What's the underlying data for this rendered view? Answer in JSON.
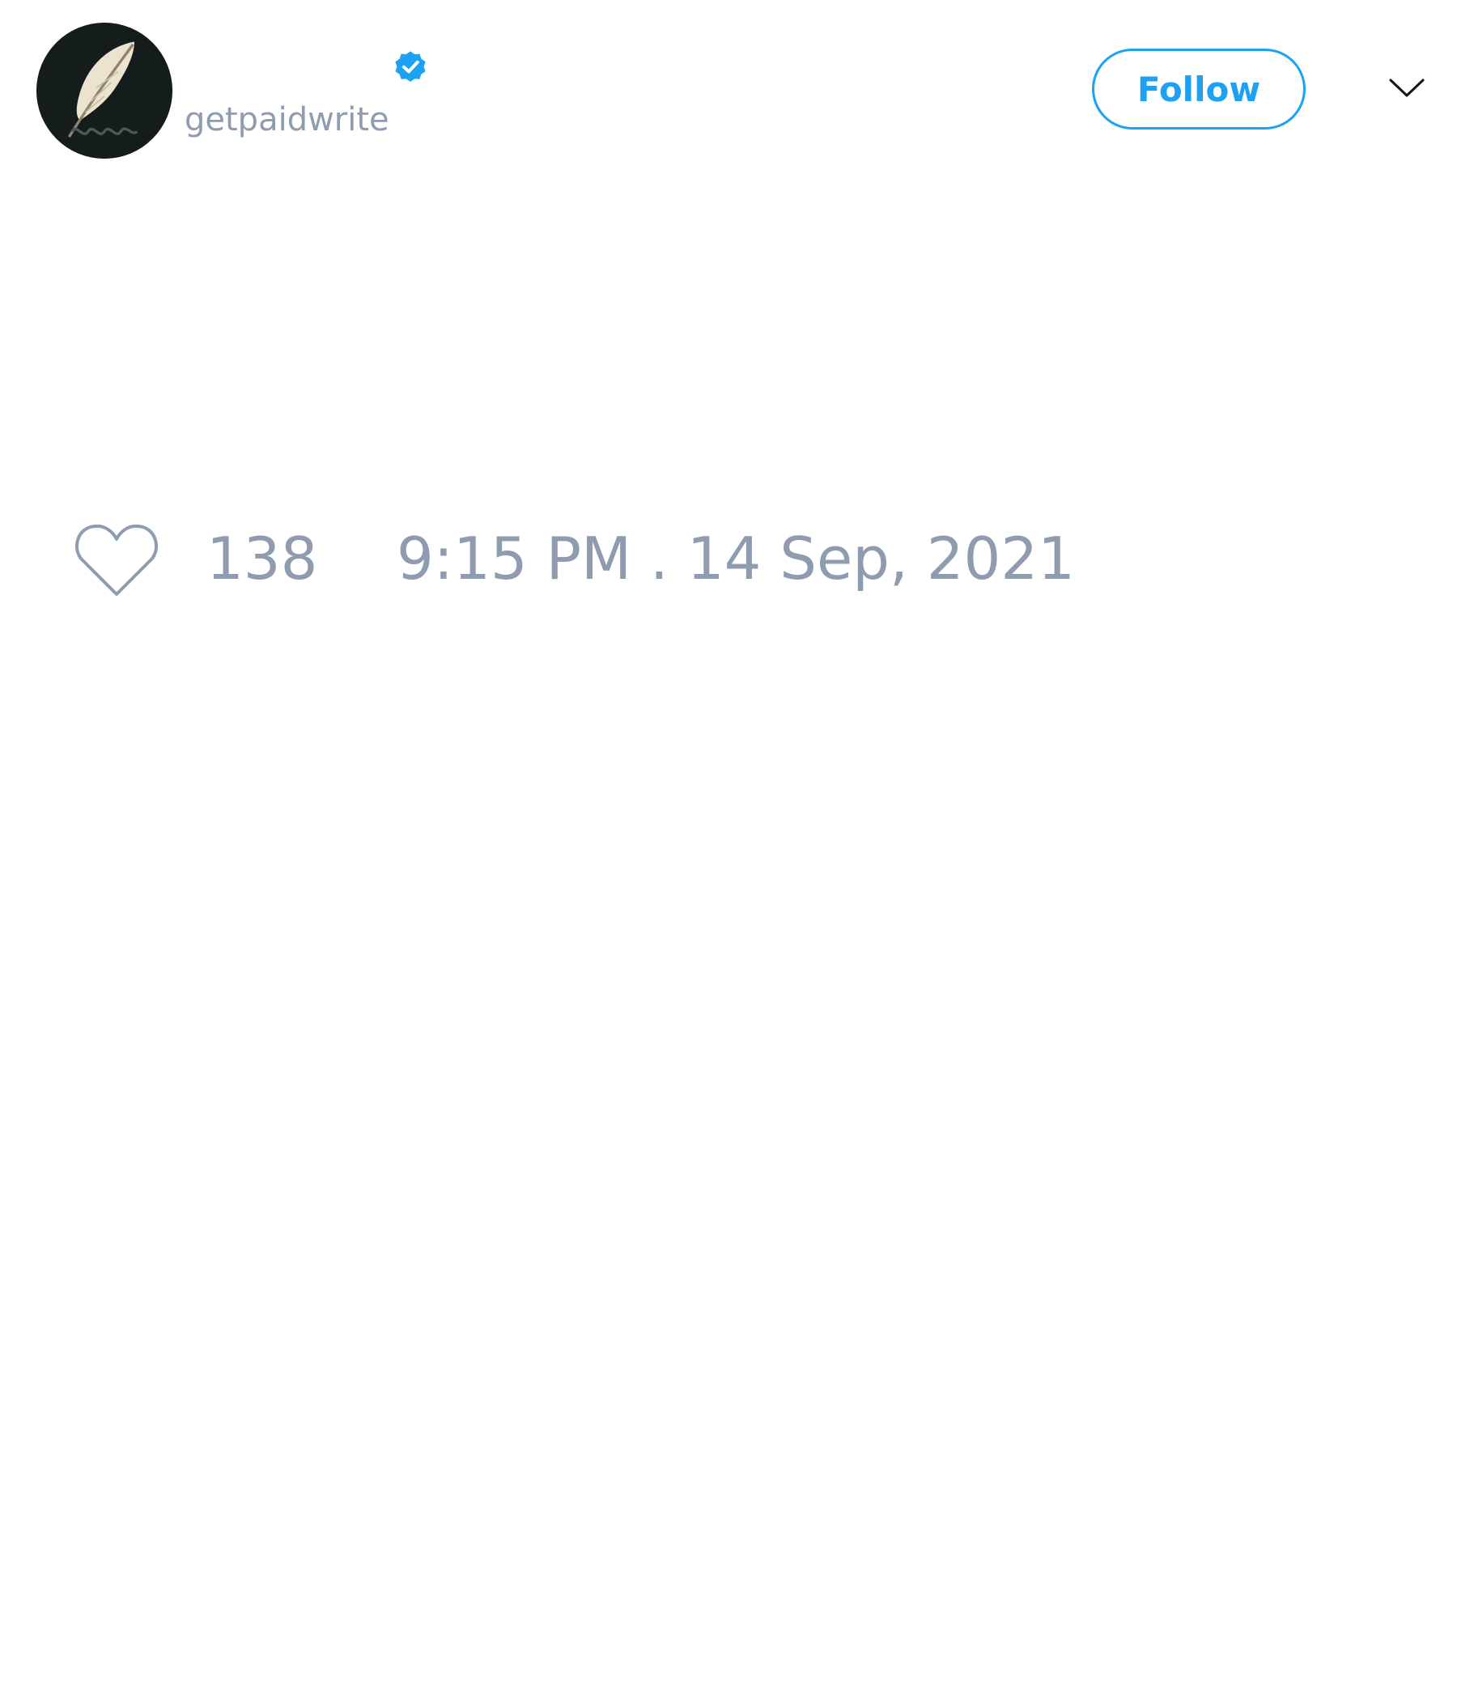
{
  "tweet": {
    "author": {
      "display_name": "",
      "handle": "getpaidwrite",
      "verified": true,
      "avatar_icon": "quill-feather-icon"
    },
    "follow_label": "Follow",
    "more_icon": "chevron-down-icon",
    "likes": {
      "icon": "heart-icon",
      "count": "138"
    },
    "timestamp": "9:15 PM . 14 Sep, 2021"
  },
  "colors": {
    "accent": "#1da1f2",
    "muted_text": "#8f9cb0",
    "avatar_bg": "#141c1c",
    "background": "#ffffff"
  }
}
